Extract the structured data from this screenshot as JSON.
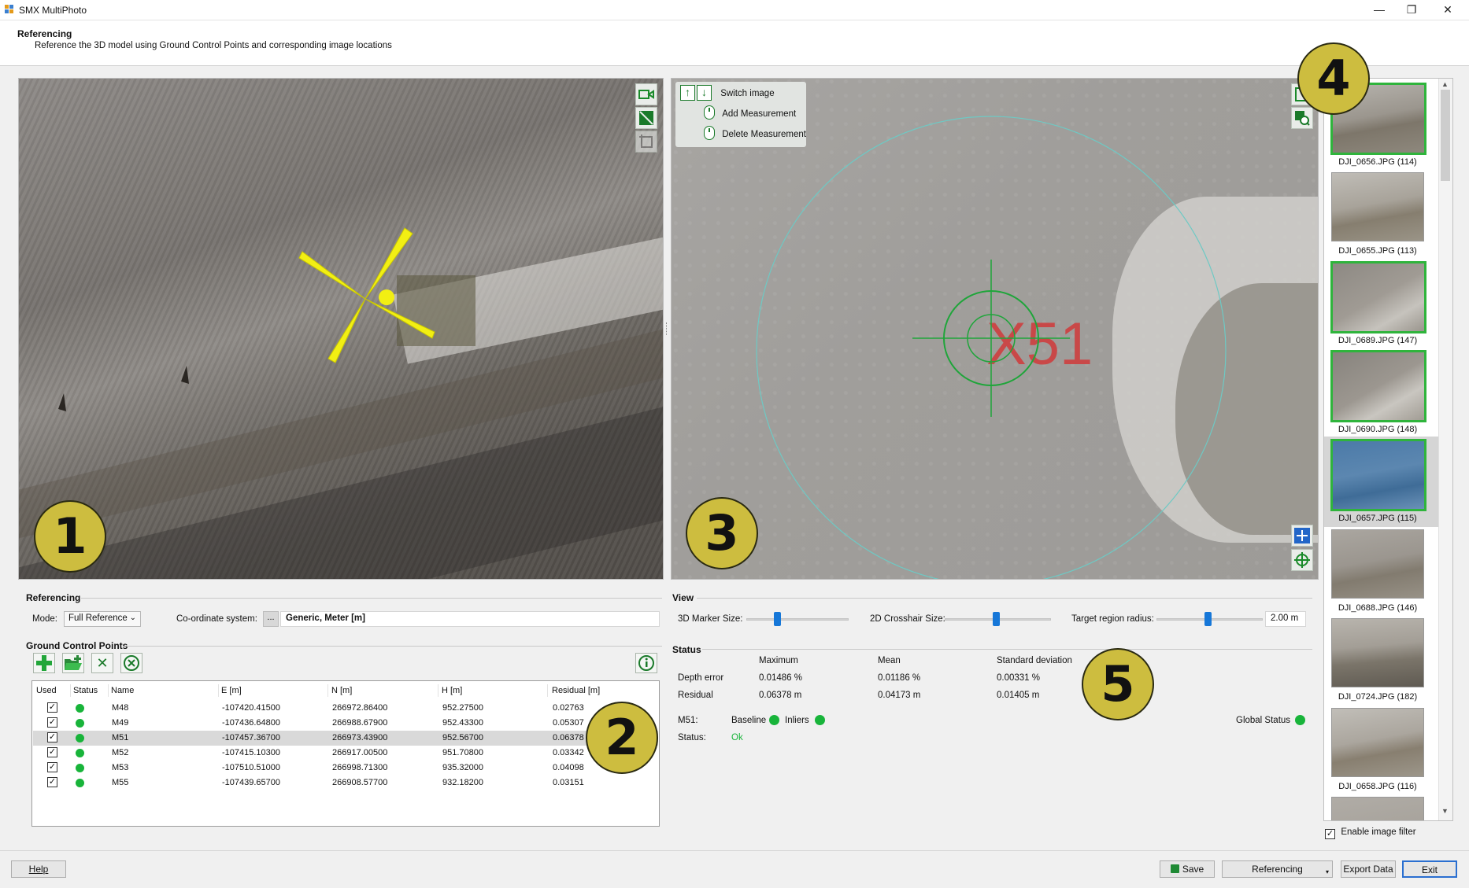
{
  "app": {
    "title": "SMX MultiPhoto",
    "window_controls": [
      "—",
      "❐",
      "✕"
    ]
  },
  "header": {
    "title": "Referencing",
    "subtitle": "Reference the 3D model using Ground Control Points and corresponding image locations"
  },
  "badges": [
    "1",
    "2",
    "3",
    "4",
    "5"
  ],
  "viewer2d_legend": {
    "switch_image": "Switch image",
    "add_measurement": "Add Measurement",
    "delete_measurement": "Delete Measurement"
  },
  "viewer2d_marker_text": "X51",
  "thumbnails": [
    {
      "label": "DJI_0656.JPG (114)",
      "selected": true
    },
    {
      "label": "DJI_0655.JPG (113)",
      "selected": false
    },
    {
      "label": "DJI_0689.JPG (147)",
      "selected": true
    },
    {
      "label": "DJI_0690.JPG (148)",
      "selected": true
    },
    {
      "label": "DJI_0657.JPG (115)",
      "selected": true
    },
    {
      "label": "DJI_0688.JPG (146)",
      "selected": false
    },
    {
      "label": "DJI_0724.JPG (182)",
      "selected": false
    },
    {
      "label": "DJI_0658.JPG (116)",
      "selected": false
    }
  ],
  "enable_image_filter": {
    "label": "Enable image filter",
    "checked": true
  },
  "referencing": {
    "section_title": "Referencing",
    "mode_label": "Mode:",
    "mode_value": "Full Reference",
    "coord_label": "Co-ordinate system:",
    "coord_button": "...",
    "coord_value": "Generic, Meter [m]"
  },
  "gcp": {
    "section_title": "Ground Control Points",
    "columns": [
      "Used",
      "Status",
      "Name",
      "E [m]",
      "N [m]",
      "H [m]",
      "Residual [m]"
    ],
    "rows": [
      {
        "used": true,
        "name": "M48",
        "e": "-107420.41500",
        "n": "266972.86400",
        "h": "952.27500",
        "residual": "0.02763",
        "selected": false
      },
      {
        "used": true,
        "name": "M49",
        "e": "-107436.64800",
        "n": "266988.67900",
        "h": "952.43300",
        "residual": "0.05307",
        "selected": false
      },
      {
        "used": true,
        "name": "M51",
        "e": "-107457.36700",
        "n": "266973.43900",
        "h": "952.56700",
        "residual": "0.06378",
        "selected": true
      },
      {
        "used": true,
        "name": "M52",
        "e": "-107415.10300",
        "n": "266917.00500",
        "h": "951.70800",
        "residual": "0.03342",
        "selected": false
      },
      {
        "used": true,
        "name": "M53",
        "e": "-107510.51000",
        "n": "266998.71300",
        "h": "935.32000",
        "residual": "0.04098",
        "selected": false
      },
      {
        "used": true,
        "name": "M55",
        "e": "-107439.65700",
        "n": "266908.57700",
        "h": "932.18200",
        "residual": "0.03151",
        "selected": false
      }
    ]
  },
  "view": {
    "section_title": "View",
    "marker_size_label": "3D Marker Size:",
    "marker_size_value": 0.3,
    "crosshair_label": "2D Crosshair Size:",
    "crosshair_value": 0.48,
    "target_radius_label": "Target region radius:",
    "target_radius_slider": 0.48,
    "target_radius_value": "2.00 m"
  },
  "status": {
    "section_title": "Status",
    "headers": [
      "Maximum",
      "Mean",
      "Standard deviation"
    ],
    "rows": [
      {
        "label": "Depth error",
        "max": "0.01486 %",
        "mean": "0.01186 %",
        "std": "0.00331 %"
      },
      {
        "label": "Residual",
        "max": "0.06378 m",
        "mean": "0.04173 m",
        "std": "0.01405 m"
      }
    ],
    "point_label": "M51:",
    "baseline_label": "Baseline",
    "inliers_label": "Inliers",
    "global_status_label": "Global Status",
    "status_label": "Status:",
    "status_value": "Ok",
    "ok_color": "#18b43a"
  },
  "footer": {
    "help": "Help",
    "save": "Save",
    "referencing": "Referencing",
    "export": "Export Data",
    "exit": "Exit"
  }
}
